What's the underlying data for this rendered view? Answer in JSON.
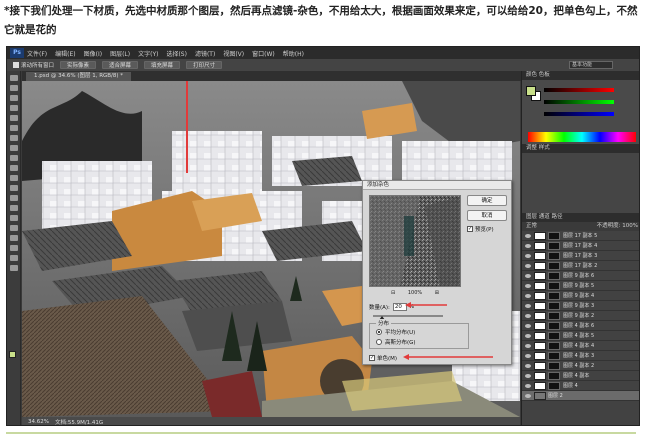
{
  "caption": {
    "line1": "*接下我们处理一下材质，先选中材质那个图层，然后再点滤镜-杂色，不用给太大，根据画面效果来定，可以给给20，把单色勾上，不然",
    "line2": "它就是花的"
  },
  "app": {
    "logo": "Ps",
    "menu": [
      "文件(F)",
      "编辑(E)",
      "图像(I)",
      "图层(L)",
      "文字(Y)",
      "选择(S)",
      "滤镜(T)",
      "视图(V)",
      "窗口(W)",
      "帮助(H)"
    ],
    "options": {
      "checkbox_label": "滚动所有窗口",
      "buttons": [
        "实际像素",
        "适合屏幕",
        "填充屏幕",
        "打印尺寸"
      ],
      "workspace": "基本功能"
    },
    "doc_tab": "1.psd @ 34.6% (图层 1, RGB/8) *",
    "status": {
      "zoom": "34.62%",
      "doc": "文档:55.9M/1.41G"
    }
  },
  "dialog": {
    "title": "添加杂色",
    "ok": "确定",
    "cancel": "取消",
    "preview_label": "预览(P)",
    "preview_checked": true,
    "zoom": "100%",
    "amount_label": "数量(A):",
    "amount_value": "20",
    "amount_unit": "%",
    "distribution_label": "分布",
    "uniform": "平均分布(U)",
    "gaussian": "高斯分布(G)",
    "distribution": "uniform",
    "mono_label": "单色(M)",
    "mono_checked": true
  },
  "panels": {
    "color_tab": "颜色  色板",
    "adjust_tab": "调整  样式",
    "layers_tab": "图层  通道  路径",
    "blend": "正常",
    "opacity": "不透明度: 100%",
    "layers": [
      "图层 17 副本 5",
      "图层 17 副本 4",
      "图层 17 副本 3",
      "图层 17 副本 2",
      "图层 9 副本 6",
      "图层 9 副本 5",
      "图层 9 副本 4",
      "图层 9 副本 3",
      "图层 9 副本 2",
      "图层 4 副本 6",
      "图层 4 副本 5",
      "图层 4 副本 4",
      "图层 4 副本 3",
      "图层 4 副本 2",
      "图层 4 副本",
      "图层 4",
      "图层 2"
    ]
  },
  "colors": {
    "annotation": "#e23a3a",
    "foreground": "#c9e08a",
    "ps_bg": "#3a3a3a"
  }
}
